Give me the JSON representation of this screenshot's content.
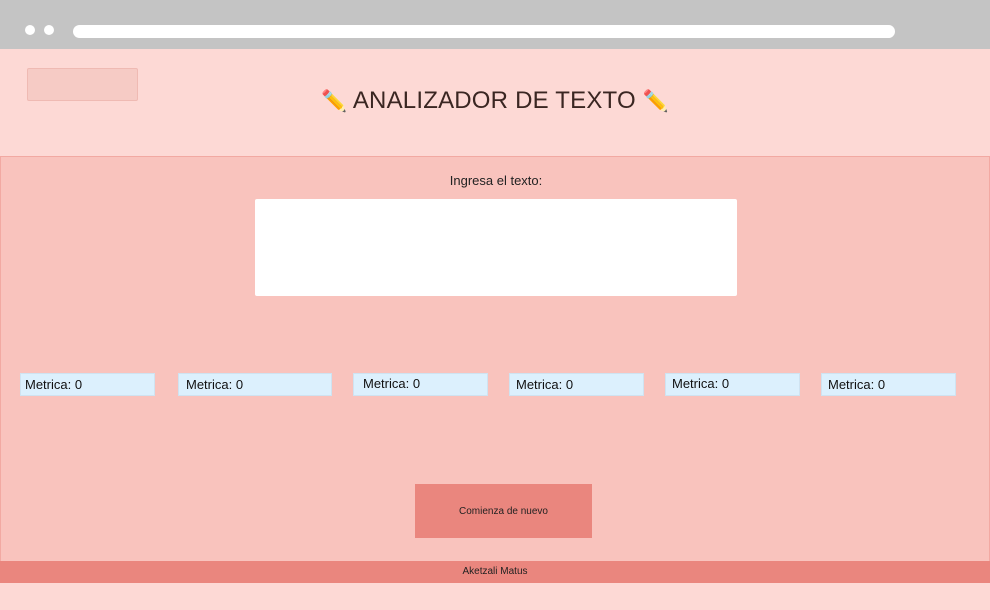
{
  "browser": {
    "window_dots": 2,
    "address_bar": ""
  },
  "header": {
    "logo_placeholder": "",
    "title_icon": "pencil-icon",
    "title_icon_glyph": "✏️",
    "title": "ANALIZADOR DE TEXTO"
  },
  "main": {
    "input_label": "Ingresa el texto:",
    "input_value": "",
    "metrics": [
      {
        "label": "Metrica: 0"
      },
      {
        "label": "Metrica: 0"
      },
      {
        "label": "Metrica: 0"
      },
      {
        "label": "Metrica: 0"
      },
      {
        "label": "Metrica: 0"
      },
      {
        "label": "Metrica: 0"
      }
    ],
    "reset_button_label": "Comienza de nuevo"
  },
  "footer": {
    "author": "Aketzali Matus"
  },
  "colors": {
    "page_background": "#fdd9d5",
    "panel_background": "#f9c3bd",
    "accent": "#ea867e",
    "metric_background": "#dcf0fd",
    "browser_chrome": "#c4c4c4"
  }
}
